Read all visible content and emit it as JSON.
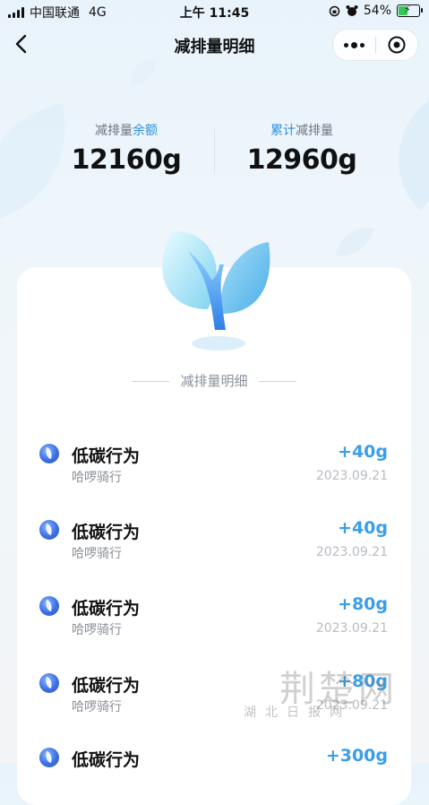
{
  "status_bar": {
    "carrier": "中国联通",
    "network": "4G",
    "time": "上午 11:45",
    "battery_percent": "54%",
    "battery_level": 0.54
  },
  "navbar": {
    "title": "减排量明细"
  },
  "stats": {
    "balance_label_prefix": "减排量",
    "balance_label_highlight": "余额",
    "balance_value": "12160g",
    "total_label_highlight": "累计",
    "total_label_suffix": "减排量",
    "total_value": "12960g"
  },
  "section_title": "减排量明细",
  "records": [
    {
      "title": "低碳行为",
      "source": "哈啰骑行",
      "amount": "+40g",
      "date": "2023.09.21"
    },
    {
      "title": "低碳行为",
      "source": "哈啰骑行",
      "amount": "+40g",
      "date": "2023.09.21"
    },
    {
      "title": "低碳行为",
      "source": "哈啰骑行",
      "amount": "+80g",
      "date": "2023.09.21"
    },
    {
      "title": "低碳行为",
      "source": "哈啰骑行",
      "amount": "+80g",
      "date": "2023.09.21"
    },
    {
      "title": "低碳行为",
      "source": "",
      "amount": "+300g",
      "date": ""
    }
  ],
  "watermark": {
    "text": "荆楚网",
    "sub_text": "湖北日报网"
  },
  "colors": {
    "accent": "#3b9ee8",
    "highlight": "#2f90dc"
  }
}
